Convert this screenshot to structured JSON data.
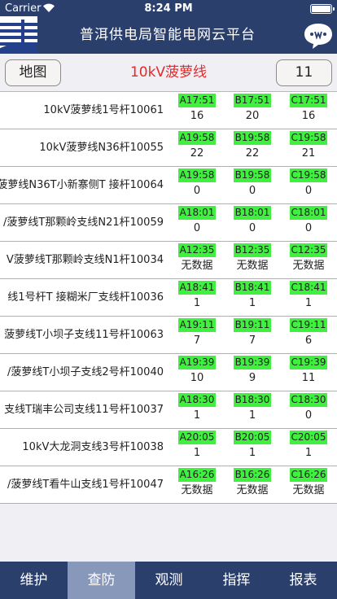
{
  "status_bar": {
    "carrier": "Carrier",
    "time": "8:24 PM"
  },
  "header": {
    "title": "普洱供电局智能电网云平台"
  },
  "controls": {
    "map_label": "地图",
    "line_name": "10kV菠萝线",
    "count": "11"
  },
  "rows": [
    {
      "name": "10kV菠萝线1号杆10061",
      "a": {
        "time": "A17:51",
        "value": "16"
      },
      "b": {
        "time": "B17:51",
        "value": "20"
      },
      "c": {
        "time": "C17:51",
        "value": "16"
      }
    },
    {
      "name": "10kV菠萝线N36杆10055",
      "a": {
        "time": "A19:58",
        "value": "22"
      },
      "b": {
        "time": "B19:58",
        "value": "22"
      },
      "c": {
        "time": "C19:58",
        "value": "21"
      }
    },
    {
      "name": "菠萝线N36T小新寨侧T 接杆10064",
      "a": {
        "time": "A19:58",
        "value": "0"
      },
      "b": {
        "time": "B19:58",
        "value": "0"
      },
      "c": {
        "time": "C19:58",
        "value": "0"
      }
    },
    {
      "name": "/菠萝线T那颗岭支线N21杆10059",
      "a": {
        "time": "A18:01",
        "value": "0"
      },
      "b": {
        "time": "B18:01",
        "value": "0"
      },
      "c": {
        "time": "C18:01",
        "value": "0"
      }
    },
    {
      "name": "V菠萝线T那颗岭支线N1杆10034",
      "a": {
        "time": "A12:35",
        "value": "无数据"
      },
      "b": {
        "time": "B12:35",
        "value": "无数据"
      },
      "c": {
        "time": "C12:35",
        "value": "无数据"
      }
    },
    {
      "name": "线1号杆T 接糊米厂支线杆10036",
      "a": {
        "time": "A18:41",
        "value": "1"
      },
      "b": {
        "time": "B18:41",
        "value": "1"
      },
      "c": {
        "time": "C18:41",
        "value": "1"
      }
    },
    {
      "name": "菠萝线T小坝子支线11号杆10063",
      "a": {
        "time": "A19:11",
        "value": "7"
      },
      "b": {
        "time": "B19:11",
        "value": "7"
      },
      "c": {
        "time": "C19:11",
        "value": "6"
      }
    },
    {
      "name": "/菠萝线T小坝子支线2号杆10040",
      "a": {
        "time": "A19:39",
        "value": "10"
      },
      "b": {
        "time": "B19:39",
        "value": "9"
      },
      "c": {
        "time": "C19:39",
        "value": "11"
      }
    },
    {
      "name": "支线T瑞丰公司支线11号杆10037",
      "a": {
        "time": "A18:30",
        "value": "1"
      },
      "b": {
        "time": "B18:30",
        "value": "1"
      },
      "c": {
        "time": "C18:30",
        "value": "0"
      }
    },
    {
      "name": "10kV大龙洞支线3号杆10038",
      "a": {
        "time": "A20:05",
        "value": "1"
      },
      "b": {
        "time": "B20:05",
        "value": "1"
      },
      "c": {
        "time": "C20:05",
        "value": "1"
      }
    },
    {
      "name": "/菠萝线T看牛山支线1号杆10047",
      "a": {
        "time": "A16:26",
        "value": "无数据"
      },
      "b": {
        "time": "B16:26",
        "value": "无数据"
      },
      "c": {
        "time": "C16:26",
        "value": "无数据"
      }
    }
  ],
  "tabs": [
    "维护",
    "查防",
    "观测",
    "指挥",
    "报表"
  ],
  "colors": {
    "nav": "#2b3f6d",
    "tab_active": "#8798bb",
    "accent_red": "#e22a2a",
    "phase_tag": "#3ff03f"
  }
}
